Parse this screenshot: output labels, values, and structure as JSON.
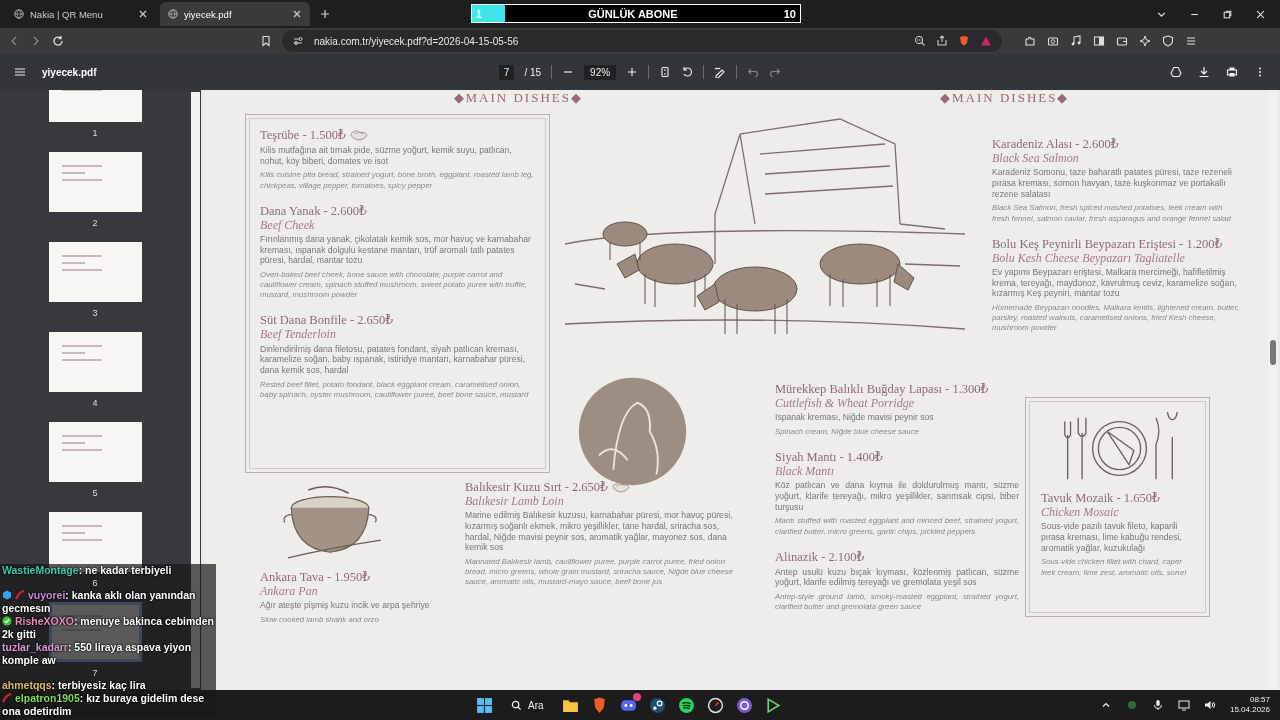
{
  "browser": {
    "tabs": [
      {
        "label": "Nakia | QR Menu",
        "selected": false
      },
      {
        "label": "yiyecek.pdf",
        "selected": true
      }
    ],
    "url": "nakia.com.tr/yiyecek.pdf?d=2026-04-15-05-56"
  },
  "goal_overlay": {
    "current": "1",
    "title": "GÜNLÜK ABONE",
    "target": "10",
    "level": 0.1
  },
  "pdf_toolbar": {
    "filename": "yiyecek.pdf",
    "page": "7",
    "page_total": "/ 15",
    "zoom": "92%"
  },
  "thumbnails": [
    {
      "label": "1",
      "selected": false
    },
    {
      "label": "2",
      "selected": false
    },
    {
      "label": "3",
      "selected": false
    },
    {
      "label": "4",
      "selected": false
    },
    {
      "label": "5",
      "selected": false
    },
    {
      "label": "6",
      "selected": false
    },
    {
      "label": "7",
      "selected": true
    }
  ],
  "page": {
    "headers": [
      "◆MAIN DISHES◆",
      "◆MAIN DISHES◆"
    ],
    "boxed_dishes": [
      {
        "title": "Teşrübe - 1.500₺",
        "decor_icon": true,
        "description": "Kilis mutfağına ait tırnak pide, süzme yoğurt, kemik suyu, patlıcan, nohut, köy biberi, domates ve isot",
        "translation": "Kilis cuisine pita bread, strained yogurt, bone broth, eggplant, roasted lamb leg, chickpeas, village pepper, tomatoes, spicy pepper"
      },
      {
        "title": "Dana Yanak - 2.600₺",
        "subtitle": "Beef Cheek",
        "decor_icon": false,
        "description": "Fırınlanmış dana yanak, çikolatalı kemik sos, mor havuç ve karnabahar kreması, ıspanak dolgulu kestane mantarı, trüf aromalı tatlı patates püresi, hardal, mantar tozu",
        "translation": "Oven-baked beef cheek, bone sauce with chocolate, purple carrot and cauliflower cream, spinach stuffed mushroom, sweet potato puree with truffle, mustard, mushroom powder"
      },
      {
        "title": "Süt Dana Bonfile - 2.650₺",
        "subtitle": "Beef Tenderloin",
        "decor_icon": false,
        "description": "Dinlendirilmiş dana filetosu, patates fondant, siyah patlıcan kreması, karamelize soğan, baby ıspanak, istiridye mantarı, karnabahar püresi, dana kemik sos, hardal",
        "translation": "Rested beef fillet, potato fondant, black eggplant cream, caramelised onion, baby spinach, oyster mushroom, cauliflower puree, beef bone sauce, mustard"
      }
    ],
    "pot_dish": {
      "title": "Ankara Tava - 1.950₺",
      "subtitle": "Ankara Pan",
      "description": "Ağır ateşte pişmiş kuzu incik ve arpa şehriye",
      "translation": "Slow cooked lamb shank and orzo"
    },
    "center_dish": {
      "title": "Balıkesir Kuzu Sırt - 2.650₺",
      "subtitle": "Balıkesir Lamb Loin",
      "decor_icon": true,
      "description": "Marine edilmiş Balıkesir kuzusu, karnabahar püresi, mor havuç püresi, kızarmış soğanlı ekmek, mikro yeşillikler, tane hardal, sriracha sos, hardal, Niğde mavisi peynir sos, aromatik yağlar, mayonez sos, dana kemik sos",
      "translation": "Marinated Balıkesir lamb, cauliflower puree, purple carrot puree, fried onion bread, micro greens, whole grain mustard, sriracha sauce, Niğde blue cheese sauce, aromatic oils, mustard-mayo sauce, beef bone jus"
    },
    "right_top_dishes": [
      {
        "title": "Karadeniz Alası - 2.600₺",
        "subtitle": "Black Sea Salmon",
        "description": "Karadeniz Somonu, taze baharatlı patates püresi, taze rezeneli pırasa kreması, somon havyarı, taze kuşkonmaz ve portakallı rezene salatası",
        "translation": "Black Sea Salmon, fresh spiced mashed potatoes, leek cream with fresh fennel, salmon caviar, fresh asparagus and orange fennel salad"
      },
      {
        "title": "Bolu Keş Peynirli Beypazarı Eriştesi - 1.200₺",
        "subtitle": "Bolu Kesh Cheese Beypazarı Tagliatelle",
        "description": "Ev yapımı Beypazarı eriştesi, Malkara mercimeği, hafifletilmiş krema, tereyağı, maydonoz, kavrulmuş ceviz, karamelize soğan, kızarmış Keş peyniri, mantar tozu",
        "translation": "Homemade Beypazarı noodles, Malkara lentils, lightened cream, butter, parsley, roasted walnuts, caramelised onions, fried Kesh cheese, mushroom powder"
      }
    ],
    "right_middle_dishes": [
      {
        "title": "Mürekkep Balıklı Buğday Lapası - 1.300₺",
        "subtitle": "Cuttlefish & Wheat Porridge",
        "description": "Ispanak kreması, Niğde mavisi peynir sos",
        "translation": "Spinach cream, Niğde blue cheese sauce"
      },
      {
        "title": "Siyah Mantı - 1.400₺",
        "subtitle": "Black Mantı",
        "description": "Köz patlıcan ve dana kıyma ile doldurulmuş mantı, süzme yoğurt, klarife tereyağı, mikro yeşillikler, sarımsak cipsi, biber turşusu",
        "translation": "Mantı stuffed with roasted eggplant and minced beef, strained yogurt, clarified butter, micro greens, garlic chips, pickled peppers"
      },
      {
        "title": "Alinazik - 2.100₺",
        "description": "Antep usulü kuzu bıçak kıyması, közlenmiş patlıcan, süzme yoğurt, klarife edilmiş tereyağı ve gremolata yeşil sos",
        "translation": "Antep-style ground lamb, smoky-roasted eggplant, strained yogurt, clarified butter and gremolata green sauce"
      }
    ],
    "featured_dish": {
      "title": "Tavuk Mozaik - 1.650₺",
      "subtitle": "Chicken Mosaic",
      "description": "Sous-vide pazılı tavuk fileto, kaparili pırasa kreması, lime kabuğu rendesi, aromatik yağlar, kuzukulağı",
      "translation": "Sous-vide chicken fillet with chard, caper leek cream, lime zest, aromatic oils, sorrel"
    }
  },
  "chat": [
    {
      "user": "WastieMontage",
      "color": "#3fcaa4",
      "cube_badge": false,
      "slash_badge": false,
      "check_badge": false,
      "text": ": ne kadar terbiyeli"
    },
    {
      "user": "vuyorei",
      "color": "#c98be0",
      "cube_badge": true,
      "slash_badge": true,
      "check_badge": false,
      "text": ": kanka aklı olan yanından gecmesın"
    },
    {
      "user": "RisheXOXO",
      "color": "#e28cb8",
      "cube_badge": false,
      "slash_badge": false,
      "check_badge": true,
      "text": ": menuye bakinca cebimden 2k gitti"
    },
    {
      "user": "tuzlar_kadarr",
      "color": "#d99ad6",
      "cube_badge": false,
      "slash_badge": false,
      "check_badge": false,
      "text": ": 550 liraya aspava yiyon komple aw"
    },
    {
      "user": "ahmetqqs",
      "color": "#e0b66e",
      "cube_badge": false,
      "slash_badge": false,
      "check_badge": false,
      "text": ": terbiyesiz kaç lira"
    },
    {
      "user": "elpatron1905",
      "color": "#7fdc5f",
      "cube_badge": false,
      "slash_badge": true,
      "check_badge": false,
      "text": ": kız buraya gidelim dese ona odetirdim"
    }
  ],
  "taskbar": {
    "search": "Ara",
    "time": "08:57",
    "date": "15.04.2026"
  }
}
